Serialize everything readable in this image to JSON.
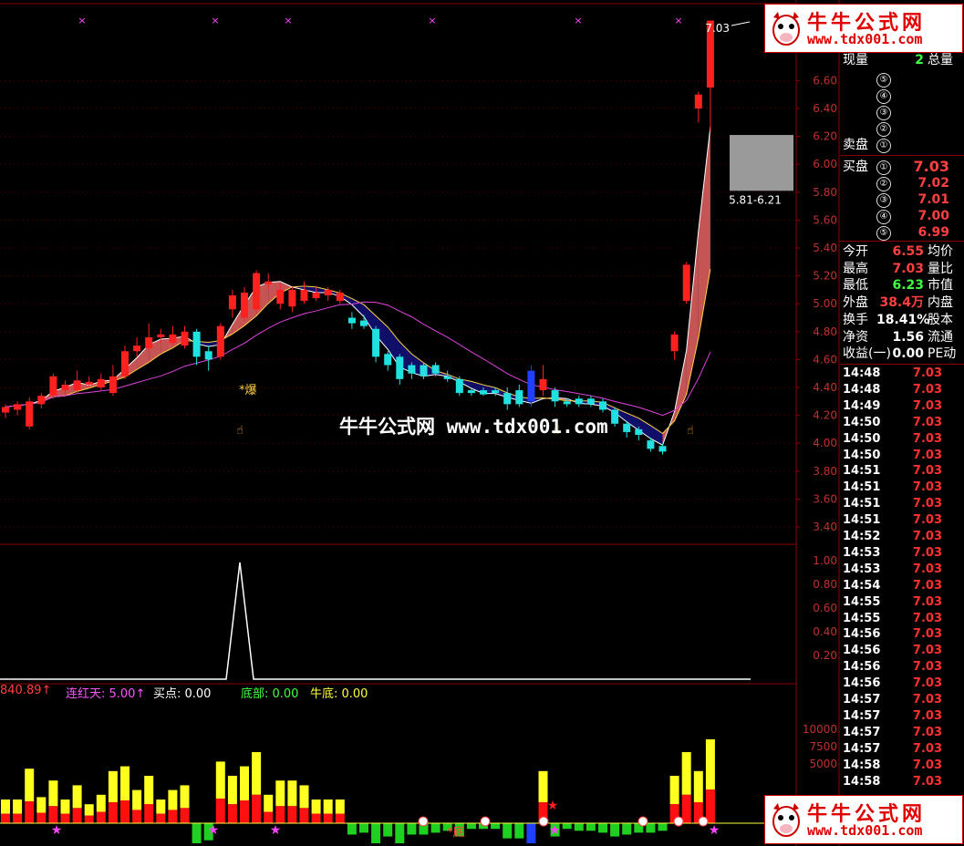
{
  "watermark": {
    "brand": "牛牛公式网",
    "url": "www.tdx001.com",
    "center_text": "牛牛公式网 www.tdx001.com"
  },
  "main_chart": {
    "price_axis": [
      "6.60",
      "6.40",
      "6.20",
      "6.00",
      "5.80",
      "5.60",
      "5.40",
      "5.20",
      "5.00",
      "4.80",
      "4.60",
      "4.40",
      "4.20",
      "4.00",
      "3.80",
      "3.60",
      "3.40"
    ],
    "high_label": "7.03",
    "range_label": "5.81-6.21",
    "annotation_bao": "*爆",
    "candles": [
      {
        "o": 4.22,
        "c": 4.26,
        "h": 4.28,
        "l": 4.18,
        "col": "red"
      },
      {
        "o": 4.24,
        "c": 4.28,
        "h": 4.3,
        "l": 4.2,
        "col": "red"
      },
      {
        "o": 4.12,
        "c": 4.3,
        "h": 4.33,
        "l": 4.1,
        "col": "red"
      },
      {
        "o": 4.28,
        "c": 4.34,
        "h": 4.36,
        "l": 4.25,
        "col": "red"
      },
      {
        "o": 4.34,
        "c": 4.48,
        "h": 4.5,
        "l": 4.32,
        "col": "red"
      },
      {
        "o": 4.42,
        "c": 4.38,
        "h": 4.45,
        "l": 4.35,
        "col": "red"
      },
      {
        "o": 4.38,
        "c": 4.45,
        "h": 4.52,
        "l": 4.36,
        "col": "red"
      },
      {
        "o": 4.44,
        "c": 4.42,
        "h": 4.48,
        "l": 4.4,
        "col": "red"
      },
      {
        "o": 4.4,
        "c": 4.46,
        "h": 4.5,
        "l": 4.38,
        "col": "red"
      },
      {
        "o": 4.36,
        "c": 4.48,
        "h": 4.56,
        "l": 4.34,
        "col": "red"
      },
      {
        "o": 4.48,
        "c": 4.66,
        "h": 4.7,
        "l": 4.46,
        "col": "red"
      },
      {
        "o": 4.66,
        "c": 4.7,
        "h": 4.76,
        "l": 4.62,
        "col": "red"
      },
      {
        "o": 4.68,
        "c": 4.76,
        "h": 4.86,
        "l": 4.66,
        "col": "red"
      },
      {
        "o": 4.76,
        "c": 4.78,
        "h": 4.82,
        "l": 4.72,
        "col": "red"
      },
      {
        "o": 4.78,
        "c": 4.72,
        "h": 4.84,
        "l": 4.7,
        "col": "red"
      },
      {
        "o": 4.7,
        "c": 4.8,
        "h": 4.84,
        "l": 4.68,
        "col": "red"
      },
      {
        "o": 4.8,
        "c": 4.62,
        "h": 4.82,
        "l": 4.56,
        "col": "cyan"
      },
      {
        "o": 4.6,
        "c": 4.66,
        "h": 4.7,
        "l": 4.52,
        "col": "cyan"
      },
      {
        "o": 4.62,
        "c": 4.84,
        "h": 4.86,
        "l": 4.6,
        "col": "red"
      },
      {
        "o": 4.96,
        "c": 5.06,
        "h": 5.1,
        "l": 4.9,
        "col": "red"
      },
      {
        "o": 4.9,
        "c": 5.08,
        "h": 5.12,
        "l": 4.88,
        "col": "red"
      },
      {
        "o": 4.96,
        "c": 5.22,
        "h": 5.24,
        "l": 4.94,
        "col": "red"
      },
      {
        "o": 5.14,
        "c": 5.16,
        "h": 5.22,
        "l": 5.1,
        "col": "red"
      },
      {
        "o": 5.0,
        "c": 5.1,
        "h": 5.14,
        "l": 4.96,
        "col": "red"
      },
      {
        "o": 4.98,
        "c": 5.1,
        "h": 5.12,
        "l": 4.94,
        "col": "red"
      },
      {
        "o": 5.02,
        "c": 5.1,
        "h": 5.16,
        "l": 5.0,
        "col": "red"
      },
      {
        "o": 5.08,
        "c": 5.04,
        "h": 5.12,
        "l": 5.02,
        "col": "red"
      },
      {
        "o": 5.06,
        "c": 5.1,
        "h": 5.12,
        "l": 5.02,
        "col": "red"
      },
      {
        "o": 5.08,
        "c": 5.02,
        "h": 5.1,
        "l": 5.0,
        "col": "red"
      },
      {
        "o": 4.9,
        "c": 4.86,
        "h": 4.94,
        "l": 4.82,
        "col": "cyan"
      },
      {
        "o": 4.88,
        "c": 4.84,
        "h": 4.92,
        "l": 4.82,
        "col": "cyan"
      },
      {
        "o": 4.82,
        "c": 4.62,
        "h": 4.84,
        "l": 4.58,
        "col": "cyan"
      },
      {
        "o": 4.64,
        "c": 4.56,
        "h": 4.66,
        "l": 4.52,
        "col": "cyan"
      },
      {
        "o": 4.62,
        "c": 4.46,
        "h": 4.64,
        "l": 4.42,
        "col": "cyan"
      },
      {
        "o": 4.56,
        "c": 4.5,
        "h": 4.58,
        "l": 4.46,
        "col": "cyan"
      },
      {
        "o": 4.56,
        "c": 4.48,
        "h": 4.58,
        "l": 4.46,
        "col": "cyan"
      },
      {
        "o": 4.56,
        "c": 4.5,
        "h": 4.58,
        "l": 4.48,
        "col": "cyan"
      },
      {
        "o": 4.48,
        "c": 4.46,
        "h": 4.52,
        "l": 4.44,
        "col": "cyan"
      },
      {
        "o": 4.46,
        "c": 4.36,
        "h": 4.48,
        "l": 4.34,
        "col": "cyan"
      },
      {
        "o": 4.38,
        "c": 4.36,
        "h": 4.4,
        "l": 4.34,
        "col": "cyan"
      },
      {
        "o": 4.38,
        "c": 4.35,
        "h": 4.4,
        "l": 4.34,
        "col": "cyan"
      },
      {
        "o": 4.38,
        "c": 4.36,
        "h": 4.4,
        "l": 4.34,
        "col": "cyan"
      },
      {
        "o": 4.36,
        "c": 4.28,
        "h": 4.4,
        "l": 4.24,
        "col": "cyan"
      },
      {
        "o": 4.38,
        "c": 4.28,
        "h": 4.42,
        "l": 4.26,
        "col": "cyan"
      },
      {
        "o": 4.52,
        "c": 4.3,
        "h": 4.56,
        "l": 4.26,
        "col": "blue"
      },
      {
        "o": 4.46,
        "c": 4.38,
        "h": 4.56,
        "l": 4.34,
        "col": "red"
      },
      {
        "o": 4.38,
        "c": 4.3,
        "h": 4.4,
        "l": 4.26,
        "col": "cyan"
      },
      {
        "o": 4.3,
        "c": 4.28,
        "h": 4.32,
        "l": 4.26,
        "col": "cyan"
      },
      {
        "o": 4.32,
        "c": 4.28,
        "h": 4.34,
        "l": 4.26,
        "col": "cyan"
      },
      {
        "o": 4.32,
        "c": 4.28,
        "h": 4.34,
        "l": 4.26,
        "col": "cyan"
      },
      {
        "o": 4.3,
        "c": 4.24,
        "h": 4.32,
        "l": 4.22,
        "col": "cyan"
      },
      {
        "o": 4.24,
        "c": 4.14,
        "h": 4.26,
        "l": 4.12,
        "col": "cyan"
      },
      {
        "o": 4.14,
        "c": 4.08,
        "h": 4.16,
        "l": 4.04,
        "col": "cyan"
      },
      {
        "o": 4.1,
        "c": 4.06,
        "h": 4.12,
        "l": 4.02,
        "col": "cyan"
      },
      {
        "o": 4.02,
        "c": 3.96,
        "h": 4.04,
        "l": 3.94,
        "col": "cyan"
      },
      {
        "o": 3.98,
        "c": 3.94,
        "h": 4.0,
        "l": 3.92,
        "col": "cyan"
      },
      {
        "o": 4.66,
        "c": 4.78,
        "h": 4.8,
        "l": 4.6,
        "col": "red"
      },
      {
        "o": 5.02,
        "c": 5.28,
        "h": 5.3,
        "l": 5.0,
        "col": "red"
      },
      {
        "o": 6.4,
        "c": 6.5,
        "h": 6.52,
        "l": 6.3,
        "col": "red"
      },
      {
        "o": 6.55,
        "c": 7.03,
        "h": 7.03,
        "l": 6.23,
        "col": "red"
      }
    ]
  },
  "indicator": {
    "axis": [
      "1.00",
      "0.80",
      "0.60",
      "0.40",
      "0.20"
    ],
    "labels": [
      {
        "text": "840.89↑",
        "color": "#ff4040"
      },
      {
        "text": "连红天: 5.00↑",
        "color": "#ff55ff"
      },
      {
        "text": "买点: 0.00",
        "color": "#ffffff"
      },
      {
        "text": "底部: 0.00",
        "color": "#40ff40"
      },
      {
        "text": "牛底: 0.00",
        "color": "#ffff40"
      }
    ]
  },
  "volume": {
    "axis": [
      "10000",
      "7500",
      "5000"
    ],
    "annotation_di": "*底"
  },
  "quote_panel": {
    "xianliang_label": "现量",
    "xianliang_value": "2",
    "zongliang_label": "总量",
    "sell_label": "卖盘",
    "buy_label": "买盘",
    "sell_orders": [
      {
        "num": "⑤",
        "price": ""
      },
      {
        "num": "④",
        "price": ""
      },
      {
        "num": "③",
        "price": ""
      },
      {
        "num": "②",
        "price": ""
      },
      {
        "num": "①",
        "price": ""
      }
    ],
    "buy_orders": [
      {
        "num": "①",
        "price": "7.03"
      },
      {
        "num": "②",
        "price": "7.02"
      },
      {
        "num": "③",
        "price": "7.01"
      },
      {
        "num": "④",
        "price": "7.00"
      },
      {
        "num": "⑤",
        "price": "6.99"
      }
    ],
    "stats": [
      {
        "a": "今开",
        "b": "6.55",
        "bc": "#ff4040",
        "c": "均价"
      },
      {
        "a": "最高",
        "b": "7.03",
        "bc": "#ff4040",
        "c": "量比"
      },
      {
        "a": "最低",
        "b": "6.23",
        "bc": "#40ff40",
        "c": "市值"
      },
      {
        "a": "外盘",
        "b": "38.4万",
        "bc": "#ff4040",
        "c": "内盘"
      },
      {
        "a": "换手",
        "b": "18.41%",
        "bc": "#ffffff",
        "c": "股本"
      },
      {
        "a": "净资",
        "b": "1.56",
        "bc": "#ffffff",
        "c": "流通"
      },
      {
        "a": "收益(一)",
        "b": "0.00",
        "bc": "#ffffff",
        "c": "PE动"
      }
    ],
    "ticks": [
      {
        "t": "14:48",
        "p": "7.03"
      },
      {
        "t": "14:48",
        "p": "7.03"
      },
      {
        "t": "14:49",
        "p": "7.03"
      },
      {
        "t": "14:50",
        "p": "7.03"
      },
      {
        "t": "14:50",
        "p": "7.03"
      },
      {
        "t": "14:50",
        "p": "7.03"
      },
      {
        "t": "14:51",
        "p": "7.03"
      },
      {
        "t": "14:51",
        "p": "7.03"
      },
      {
        "t": "14:51",
        "p": "7.03"
      },
      {
        "t": "14:51",
        "p": "7.03"
      },
      {
        "t": "14:52",
        "p": "7.03"
      },
      {
        "t": "14:53",
        "p": "7.03"
      },
      {
        "t": "14:53",
        "p": "7.03"
      },
      {
        "t": "14:54",
        "p": "7.03"
      },
      {
        "t": "14:55",
        "p": "7.03"
      },
      {
        "t": "14:55",
        "p": "7.03"
      },
      {
        "t": "14:56",
        "p": "7.03"
      },
      {
        "t": "14:56",
        "p": "7.03"
      },
      {
        "t": "14:56",
        "p": "7.03"
      },
      {
        "t": "14:56",
        "p": "7.03"
      },
      {
        "t": "14:57",
        "p": "7.03"
      },
      {
        "t": "14:57",
        "p": "7.03"
      },
      {
        "t": "14:57",
        "p": "7.03"
      },
      {
        "t": "14:57",
        "p": "7.03"
      },
      {
        "t": "14:58",
        "p": "7.03"
      },
      {
        "t": "14:58",
        "p": "7.03"
      }
    ]
  }
}
